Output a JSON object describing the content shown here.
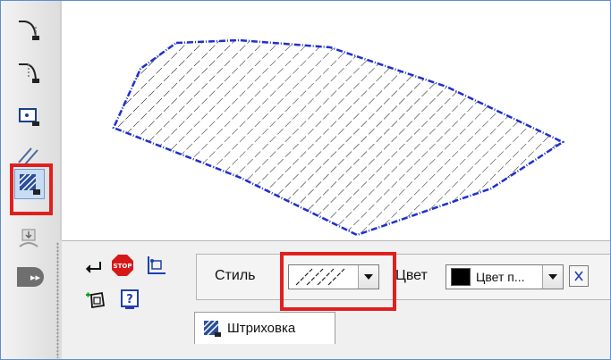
{
  "left_toolbar": {
    "tools": [
      {
        "icon": "fillet-line-icon"
      },
      {
        "icon": "fillet-line-alt-icon"
      },
      {
        "icon": "point-rect-icon"
      },
      {
        "icon": "parallel-lines-icon"
      },
      {
        "icon": "hatching-icon",
        "active": true
      },
      {
        "icon": "insert-view-icon"
      }
    ]
  },
  "command_panel": {
    "icons": [
      "enter-icon",
      "stop-icon",
      "auto-contour-icon",
      "manual-contour-icon",
      "help-icon"
    ]
  },
  "properties": {
    "style_label": "Стиль",
    "color_label": "Цвет",
    "color_value": "Цвет п...",
    "color_swatch": "#000000"
  },
  "tab": {
    "label": "Штриховка"
  },
  "colors": {
    "highlight": "#e0201f",
    "contour": "#1f2fd0",
    "frame": "#5b8fd0"
  }
}
